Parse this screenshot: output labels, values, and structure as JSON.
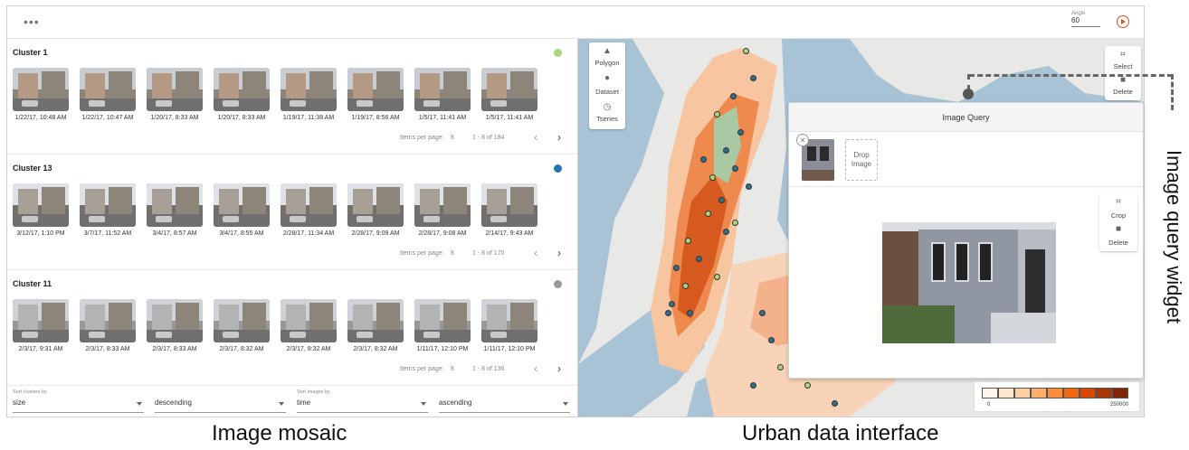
{
  "topbar": {
    "menu_label": "•••",
    "angle_label": "Angle",
    "angle_value": "60"
  },
  "clusters": [
    {
      "title": "Cluster 1",
      "dot_color": "#a8d77e",
      "dates": [
        "1/22/17, 10:48 AM",
        "1/22/17, 10:47 AM",
        "1/20/17, 8:33 AM",
        "1/20/17, 8:33 AM",
        "1/19/17, 11:38 AM",
        "1/19/17, 8:56 AM",
        "1/5/17, 11:41 AM",
        "1/5/17, 11:41 AM"
      ],
      "items_per_page_label": "Items per page:",
      "items_per_page": "8",
      "range": "1 - 8 of 184"
    },
    {
      "title": "Cluster 13",
      "dot_color": "#2a74b5",
      "dates": [
        "3/12/17, 1:10 PM",
        "3/7/17, 11:52 AM",
        "3/4/17, 8:57 AM",
        "3/4/17, 8:55 AM",
        "2/28/17, 11:34 AM",
        "2/28/17, 9:09 AM",
        "2/28/17, 9:08 AM",
        "2/14/17, 9:43 AM"
      ],
      "items_per_page_label": "Items per page:",
      "items_per_page": "8",
      "range": "1 - 8 of 170"
    },
    {
      "title": "Cluster 11",
      "dot_color": "#9a9a9a",
      "dates": [
        "2/3/17, 9:31 AM",
        "2/3/17, 8:33 AM",
        "2/3/17, 8:33 AM",
        "2/3/17, 8:32 AM",
        "2/3/17, 8:32 AM",
        "2/3/17, 8:32 AM",
        "1/11/17, 12:10 PM",
        "1/11/17, 12:10 PM"
      ],
      "items_per_page_label": "Items per page:",
      "items_per_page": "8",
      "range": "1 - 8 of 136"
    }
  ],
  "sort": {
    "clusters_label": "Sort clusters by",
    "clusters_value": "size",
    "clusters_order": "descending",
    "images_label": "Sort images by",
    "images_value": "time",
    "images_order": "ascending"
  },
  "map_tools": {
    "polygon": "Polygon",
    "dataset": "Dataset",
    "tseries": "Tseries",
    "select": "Select",
    "delete": "Delete"
  },
  "query": {
    "title": "Image Query",
    "drop_label": "Drop Image",
    "crop": "Crop",
    "delete": "Delete"
  },
  "legend": {
    "min": "0",
    "max": "250000",
    "colors": [
      "#fff5eb",
      "#fee6ce",
      "#fdd0a2",
      "#fdae6b",
      "#fd8d3c",
      "#f16913",
      "#d94801",
      "#a63603",
      "#7f2704"
    ]
  },
  "annotations": {
    "side_label": "Image query widget",
    "caption_left": "Image mosaic",
    "caption_right": "Urban data interface"
  }
}
